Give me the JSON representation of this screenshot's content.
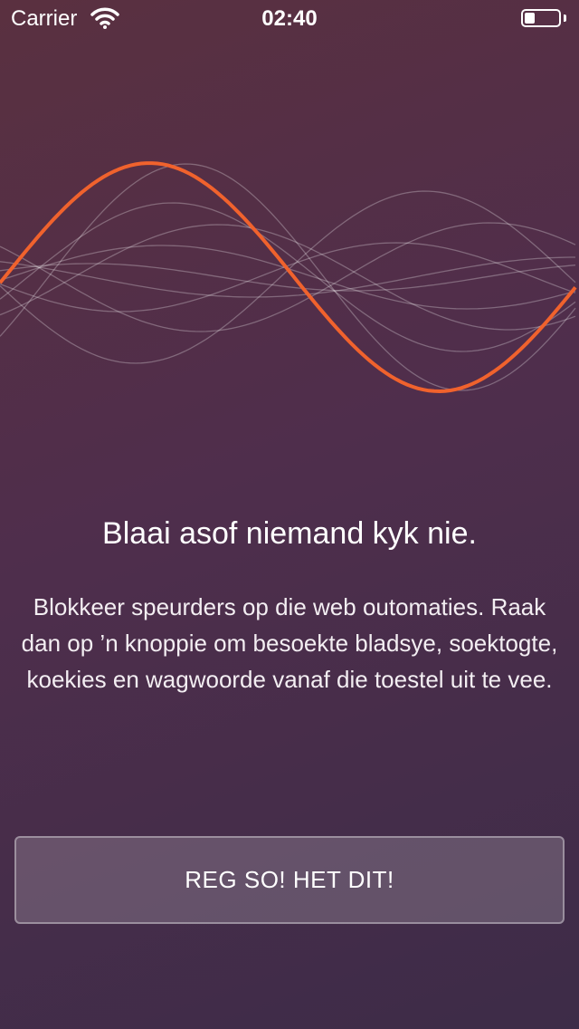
{
  "status_bar": {
    "carrier": "Carrier",
    "time": "02:40",
    "wifi_icon": "wifi-icon",
    "battery_icon": "battery-icon",
    "battery_level": 0.3
  },
  "onboarding": {
    "headline": "Blaai asof niemand kyk nie.",
    "body": "Blokkeer speurders op die web outomaties. Raak dan op ’n knoppie om besoekte bladsye, soektogte, koekies en wagwoorde vanaf die toestel uit te vee.",
    "cta_label": "REG SO! HET DIT!"
  },
  "colors": {
    "accent": "#f0622d",
    "background_start": "#5a3040",
    "background_end": "#3d2c48"
  }
}
